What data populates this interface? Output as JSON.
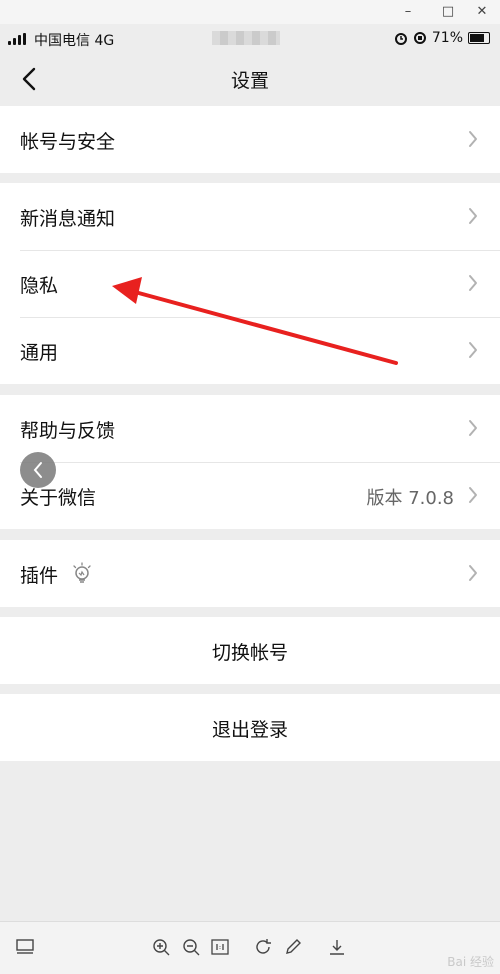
{
  "window": {
    "minimize": "–",
    "maximize": "□",
    "close": "✕"
  },
  "status": {
    "carrier": "中国电信 4G",
    "battery": "71%"
  },
  "nav": {
    "title": "设置"
  },
  "groups": [
    {
      "items": [
        {
          "label": "帐号与安全"
        }
      ]
    },
    {
      "items": [
        {
          "label": "新消息通知"
        },
        {
          "label": "隐私"
        },
        {
          "label": "通用"
        }
      ]
    },
    {
      "items": [
        {
          "label": "帮助与反馈"
        },
        {
          "label": "关于微信",
          "value": "版本 7.0.8"
        }
      ]
    },
    {
      "items": [
        {
          "label": "插件"
        }
      ]
    }
  ],
  "actions": {
    "switch_account": "切换帐号",
    "logout": "退出登录"
  },
  "watermark": "Bai 经验",
  "colors": {
    "accent": "#e8211f",
    "background": "#ededed"
  }
}
